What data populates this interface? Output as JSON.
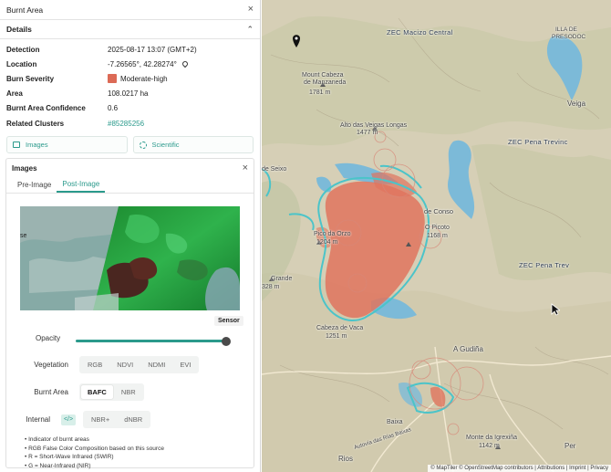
{
  "panel": {
    "title": "Burnt Area",
    "details_title": "Details",
    "rows": [
      {
        "label": "Detection",
        "value": "2025-08-17 13:07 (GMT+2)"
      },
      {
        "label": "Location",
        "value": "-7.26565°, 42.28274°"
      },
      {
        "label": "Burn Severity",
        "value": "Moderate-high"
      },
      {
        "label": "Area",
        "value": "108.0217 ha"
      },
      {
        "label": "Burnt Area Confidence",
        "value": "0.6"
      },
      {
        "label": "Related Clusters",
        "value": "#85285256"
      }
    ],
    "severity_color": "#dc6a56",
    "accent_color": "#2b9a8c",
    "buttons": {
      "images": "Images",
      "scientific": "Scientific"
    }
  },
  "images": {
    "title": "Images",
    "tabs": [
      "Pre-Image",
      "Post-Image"
    ],
    "sensor_label": "Sensor",
    "opacity_label": "Opacity",
    "opacity_value": 1.0,
    "vegetation_label": "Vegetation",
    "vegetation_options": [
      "RGB",
      "NDVI",
      "NDMI",
      "EVI"
    ],
    "burnt_label": "Burnt Area",
    "burnt_options": [
      "BAFC",
      "NBR"
    ],
    "internal_label": "Internal",
    "internal_code": "</>",
    "internal_options": [
      "NBR+",
      "dNBR"
    ],
    "notes": [
      "• Indicator of burnt areas",
      "• RGB False Color Composition based on this source",
      "• R = Short-Wave Infrared (SWIR)",
      "• G = Near-Infrared (NIR)"
    ],
    "sat_fragment": "se"
  },
  "map": {
    "labels": {
      "zec_macizo": "ZEC Macizo Central",
      "illa": "ILLA DE",
      "prezodoc": "PRESODOC",
      "mount_cabeza": "Mount Cabeza",
      "de_manzaneda": "de Manzaneda",
      "m1781": "1781 m",
      "alto": "Alto das Veigas Longas",
      "m1477": "1477 m",
      "veiga": "Veiga",
      "zec_pena": "ZEC Pena Trevinc",
      "zec_pena2": "ZEC Pena Trev",
      "seixo": "de Seixo",
      "conso": "de Conso",
      "picoto": "O Picoto",
      "m1168": "1168 m",
      "pico": "Pico da Orzo",
      "m1204": "1204 m",
      "grande": "Grande",
      "m328": "328 m",
      "cabeza_vaca": "Cabeza de Vaca",
      "m1251": "1251 m",
      "gudina": "A Gudiña",
      "baixa": "Baixa",
      "rios": "Rios",
      "monte": "Monte da Igrexiña",
      "m1142": "1142 m",
      "per": "Per",
      "autovia": "Autovía das Rías Baixas"
    },
    "attribution": "© MapTiler © OpenStreetMap contributors | Attributions | Imprint | Privacy",
    "colors": {
      "burn": "#e0745e",
      "perimeter": "#4bc4c9",
      "water": "#7cbad8"
    }
  }
}
